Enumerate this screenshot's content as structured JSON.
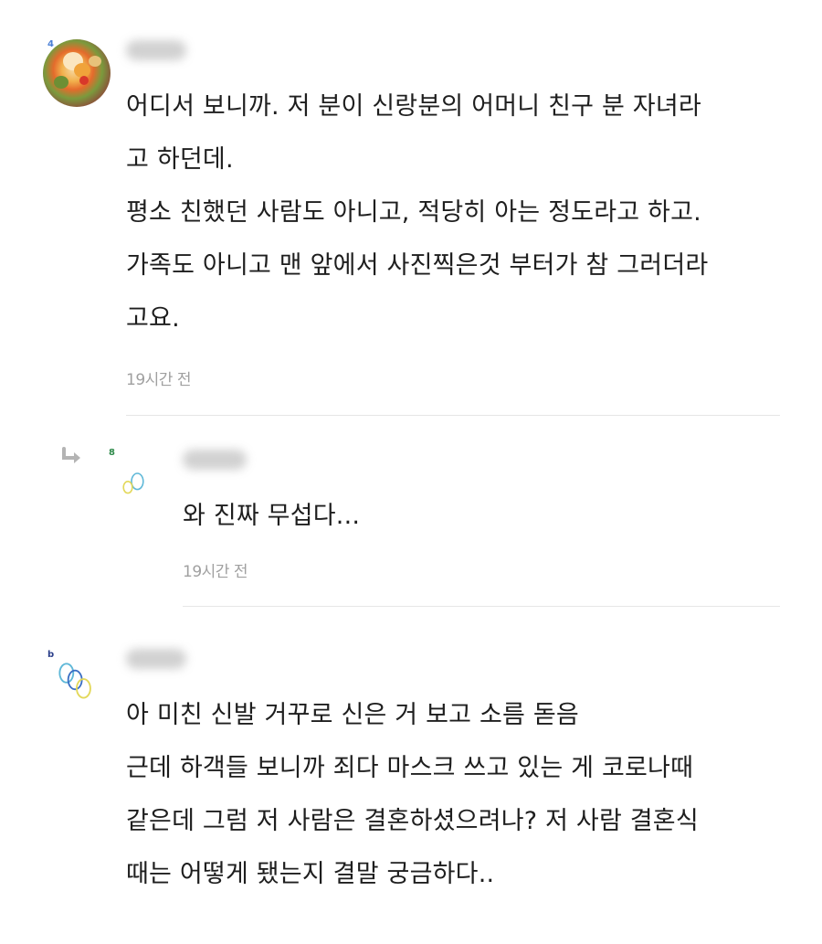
{
  "comments": [
    {
      "level_badge": "4",
      "body_lines": [
        "어디서 보니까. 저 분이 신랑분의 어머니 친구 분 자녀라",
        "고 하던데.",
        "평소 친했던 사람도 아니고, 적당히 아는 정도라고 하고.",
        "가족도 아니고 맨 앞에서 사진찍은것 부터가 참 그러더라",
        "고요."
      ],
      "timestamp": "19시간 전"
    },
    {
      "level_badge": "8",
      "body_lines": [
        "와 진짜 무섭다..."
      ],
      "timestamp": "19시간 전"
    },
    {
      "level_badge": "b",
      "body_lines": [
        "아 미친 신발 거꾸로 신은 거 보고 소름 돋음",
        "근데 하객들 보니까 죄다 마스크 쓰고 있는 게 코로나때",
        "같은데 그럼 저 사람은 결혼하셨으려나? 저 사람 결혼식",
        "때는 어떻게 됐는지 결말 궁금하다.."
      ]
    }
  ],
  "colors": {
    "text": "#1e1e1e",
    "timestamp": "#a0a0a0",
    "divider": "#e6e6e6",
    "badge_blue": "#4a7fd6",
    "badge_green": "#2e8a4a",
    "badge_navy": "#2b3f8a"
  },
  "icons": {
    "reply": "reply-arrow-icon",
    "avatar_1": "food-photo-avatar",
    "avatar_2": "rings-avatar-icon",
    "avatar_3": "rings-avatar-icon"
  }
}
